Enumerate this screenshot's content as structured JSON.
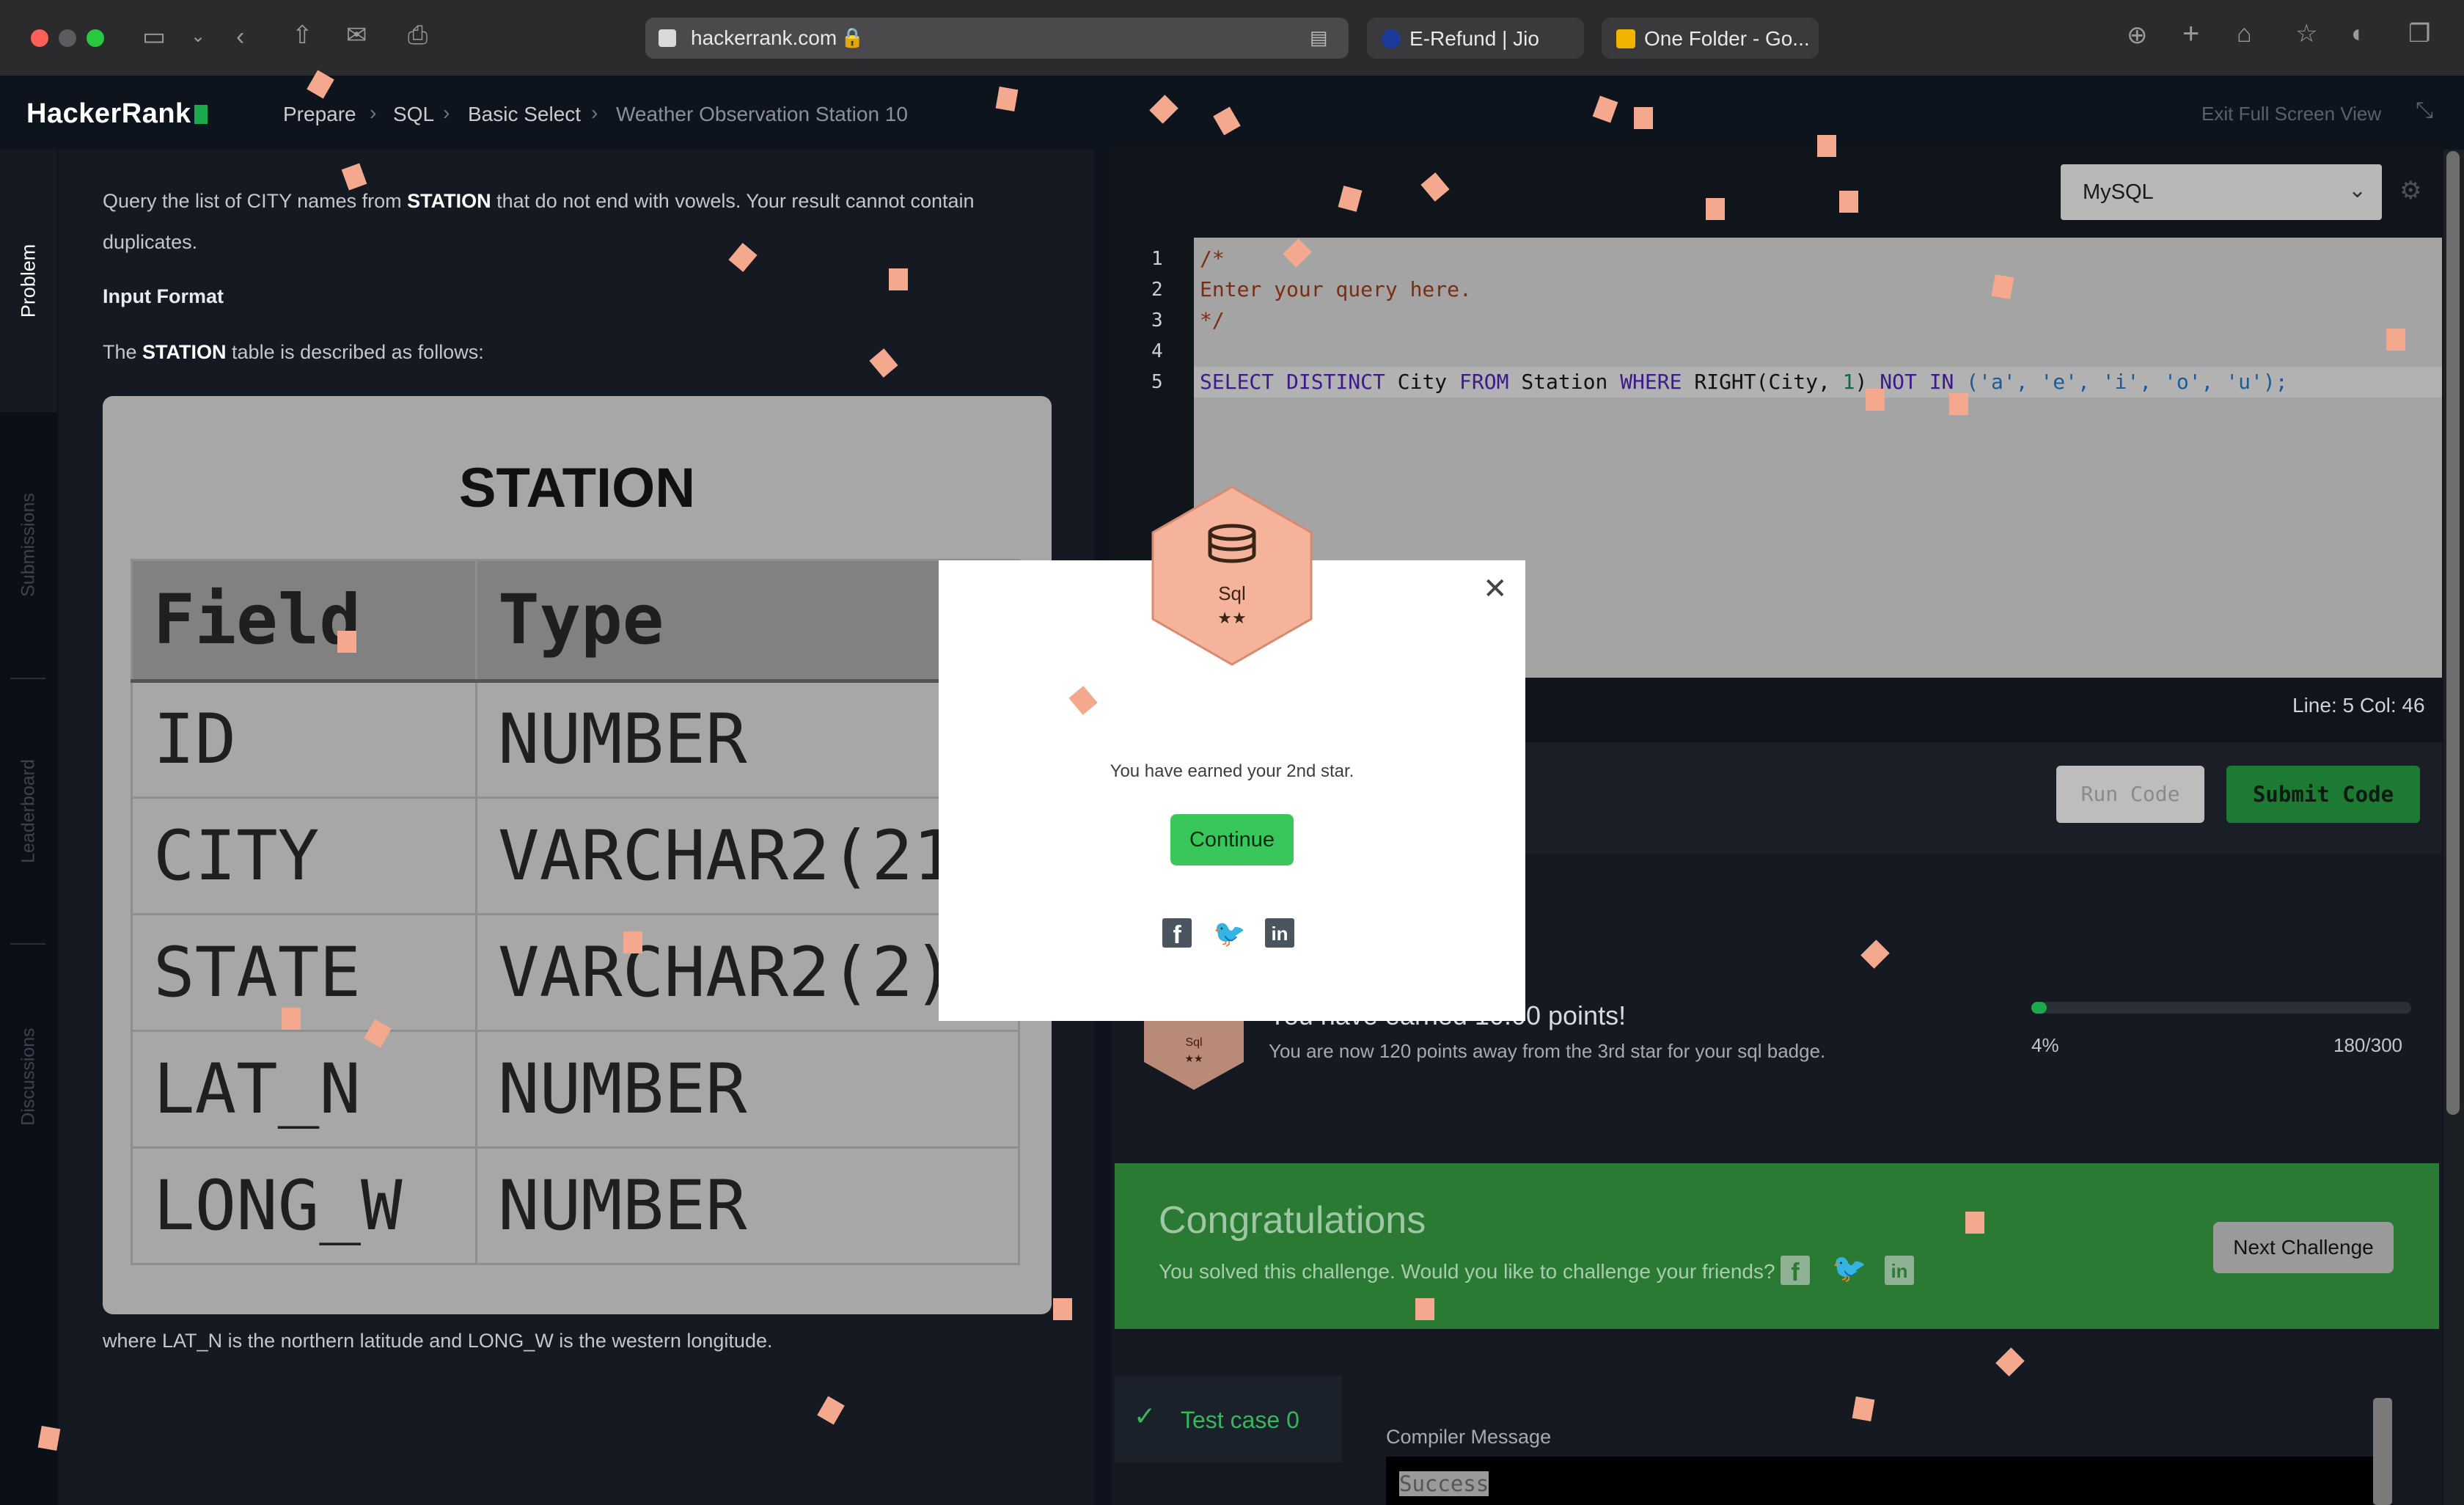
{
  "browser": {
    "url": "hackerrank.com",
    "tabs": [
      {
        "label": "E-Refund | Jio"
      },
      {
        "label": "One Folder - Go..."
      }
    ]
  },
  "header": {
    "logo": "HackerRank",
    "breadcrumb": [
      "Prepare",
      "SQL",
      "Basic Select",
      "Weather Observation Station 10"
    ],
    "exit_fullscreen": "Exit Full Screen View"
  },
  "sidebar": {
    "tabs": [
      "Problem",
      "Submissions",
      "Leaderboard",
      "Discussions"
    ]
  },
  "problem": {
    "statement_pre": "Query the list of CITY names from ",
    "statement_bold": "STATION",
    "statement_post": " that do not end with vowels. Your result cannot contain",
    "statement_line2": "duplicates.",
    "input_format": "Input Format",
    "table_desc_pre": "The ",
    "table_desc_bold": "STATION",
    "table_desc_post": " table is described as follows:",
    "table_title": "STATION",
    "table_headers": [
      "Field",
      "Type"
    ],
    "table_rows": [
      [
        "ID",
        "NUMBER"
      ],
      [
        "CITY",
        "VARCHAR2(21)"
      ],
      [
        "STATE",
        "VARCHAR2(2)"
      ],
      [
        "LAT_N",
        "NUMBER"
      ],
      [
        "LONG_W",
        "NUMBER"
      ]
    ],
    "footer_note": "where LAT_N is the northern latitude and LONG_W is the western longitude."
  },
  "editor": {
    "language": "MySQL",
    "line_numbers": [
      "1",
      "2",
      "3",
      "4",
      "5"
    ],
    "code_lines": [
      "/*",
      "Enter your query here.",
      "*/",
      "",
      "SELECT DISTINCT City FROM Station WHERE RIGHT(City, 1) NOT IN ('a', 'e', 'i', 'o', 'u');"
    ],
    "sql": {
      "select": "SELECT",
      "distinct": "DISTINCT",
      "city": "City",
      "from": "FROM",
      "station": "Station",
      "where": "WHERE",
      "right": "RIGHT",
      "open": "(",
      "city2": "City",
      "comma": ", ",
      "one": "1",
      "close": ")",
      "not": "NOT",
      "in": "IN",
      "list": "('a', 'e', 'i', 'o', 'u');"
    },
    "status": "Line: 5 Col: 46",
    "run_label": "Run Code",
    "submit_label": "Submit Code"
  },
  "results": {
    "earned": "You have earned 10.00 points!",
    "earned_sub": "You are now 120 points away from the 3rd star for your sql badge.",
    "progress_percent": "4%",
    "progress_fraction": 0.04,
    "progress_count": "180/300",
    "congrats_title": "Congratulations",
    "congrats_sub": "You solved this challenge. Would you like to challenge your friends?",
    "next_label": "Next Challenge",
    "testcase_label": "Test case 0",
    "compiler_label": "Compiler Message",
    "compiler_value": "Success",
    "badge_label": "Sql"
  },
  "modal": {
    "badge_label": "Sql",
    "badge_stars": "★★",
    "message": "You have earned your 2nd star.",
    "continue_label": "Continue",
    "close_glyph": "✕"
  },
  "colors": {
    "accent_green": "#1ba94c",
    "badge": "#f4b39a",
    "confetti": "#f4a88e"
  }
}
